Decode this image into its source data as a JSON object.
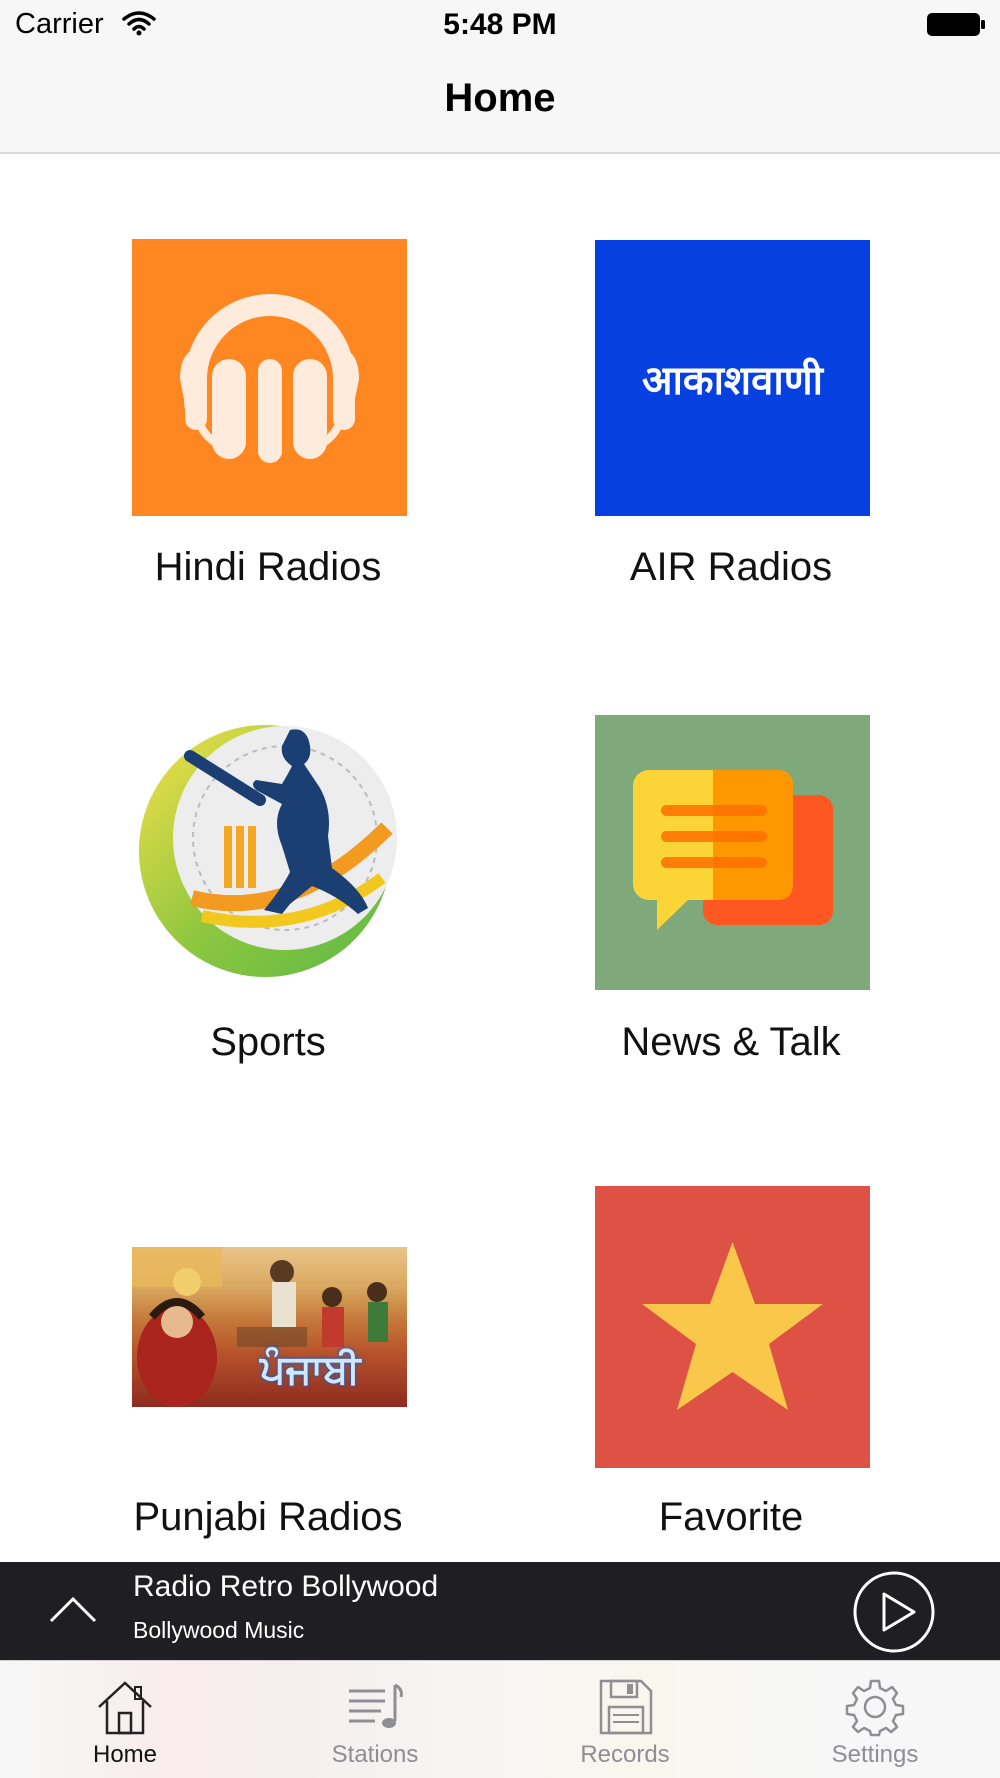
{
  "status_bar": {
    "carrier": "Carrier",
    "time": "5:48 PM"
  },
  "nav": {
    "title": "Home"
  },
  "tiles": [
    {
      "label": "Hindi Radios",
      "icon": "headphones-icon",
      "color": "#FE8721"
    },
    {
      "label": "AIR Radios",
      "image_text": "आकाशवाणी",
      "color": "#0640E0"
    },
    {
      "label": "Sports",
      "icon": "cricket-batsman-icon"
    },
    {
      "label": "News & Talk",
      "icon": "chat-bubbles-icon",
      "color": "#7FA87B"
    },
    {
      "label": "Punjabi Radios",
      "image_text": "ਪੰਜਾਬੀ"
    },
    {
      "label": "Favorite",
      "icon": "star-icon",
      "color": "#DD5244"
    }
  ],
  "player": {
    "title": "Radio Retro Bollywood",
    "subtitle": "Bollywood Music"
  },
  "tabs": [
    {
      "label": "Home",
      "icon": "home-icon",
      "active": true
    },
    {
      "label": "Stations",
      "icon": "playlist-icon",
      "active": false
    },
    {
      "label": "Records",
      "icon": "floppy-disk-icon",
      "active": false
    },
    {
      "label": "Settings",
      "icon": "gear-icon",
      "active": false
    }
  ]
}
